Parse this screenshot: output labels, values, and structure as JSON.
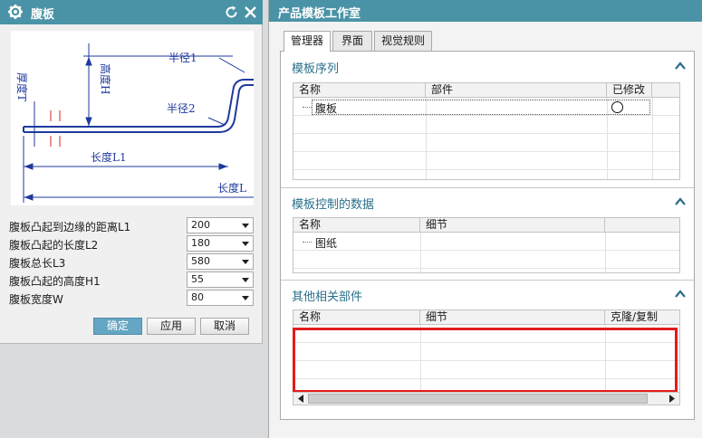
{
  "dialog": {
    "title": "腹板",
    "diagram_labels": {
      "thickness": "厚度T",
      "height": "高度H",
      "radius1": "半径1",
      "radius2": "半径2",
      "length1": "长度L1",
      "length2": "长度L"
    },
    "params": [
      {
        "label": "腹板凸起到边缘的距离L1",
        "value": "200"
      },
      {
        "label": "腹板凸起的长度L2",
        "value": "180"
      },
      {
        "label": "腹板总长L3",
        "value": "580"
      },
      {
        "label": "腹板凸起的高度H1",
        "value": "55"
      },
      {
        "label": "腹板宽度W",
        "value": "80"
      }
    ],
    "buttons": {
      "ok": "确定",
      "apply": "应用",
      "cancel": "取消"
    }
  },
  "panel": {
    "title": "产品模板工作室",
    "tabs": [
      "管理器",
      "界面",
      "视觉规则"
    ],
    "sections": {
      "sequence": {
        "title": "模板序列",
        "columns": [
          "名称",
          "部件",
          "已修改"
        ],
        "rows": [
          {
            "name": "腹板"
          }
        ]
      },
      "control": {
        "title": "模板控制的数据",
        "columns": [
          "名称",
          "细节"
        ],
        "rows": [
          {
            "name": "图纸"
          }
        ]
      },
      "related": {
        "title": "其他相关部件",
        "columns": [
          "名称",
          "细节",
          "克隆/复制"
        ]
      }
    }
  },
  "colors": {
    "titlebar": "#4a93a6",
    "section_title": "#2a6f8a",
    "highlight": "#e31b1b",
    "primary_button": "#64a6c3"
  }
}
